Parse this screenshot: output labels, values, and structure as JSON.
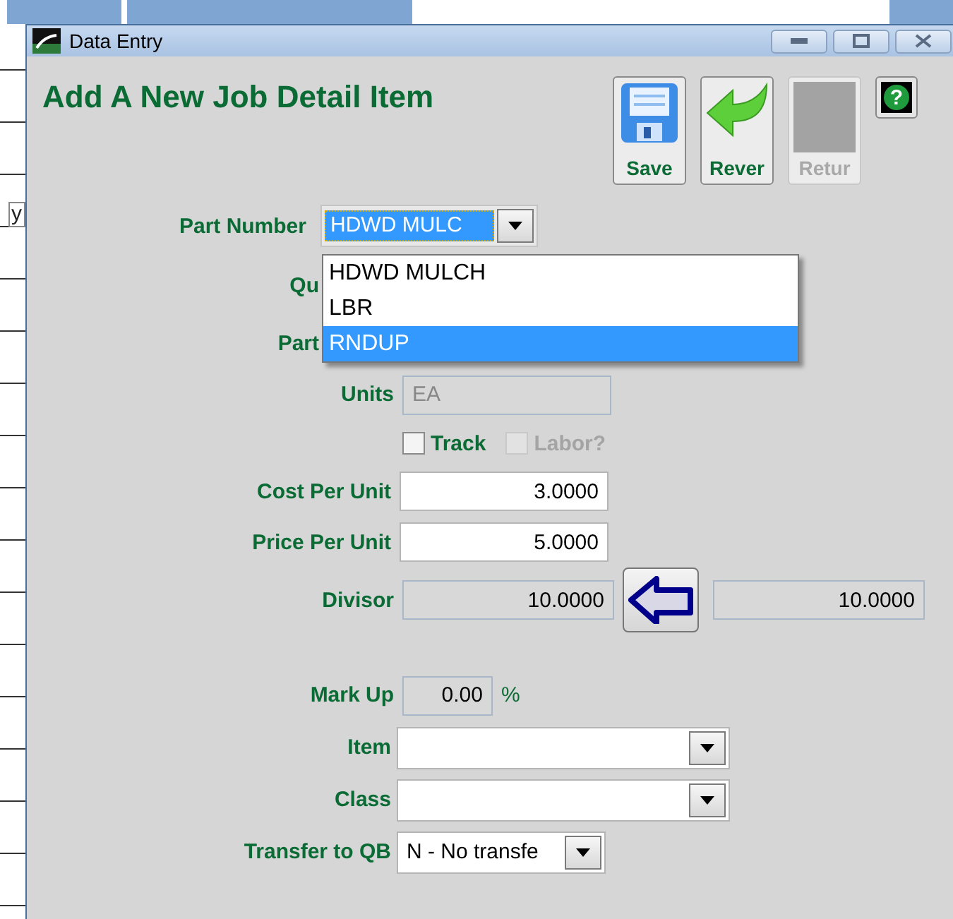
{
  "background": {
    "label": "y"
  },
  "window": {
    "title": "Data Entry"
  },
  "heading": "Add A New Job Detail Item",
  "toolbar": [
    {
      "label": "Save",
      "kind": "save",
      "disabled": false
    },
    {
      "label": "Rever",
      "kind": "revert",
      "disabled": false
    },
    {
      "label": "Retur",
      "kind": "return",
      "disabled": true
    }
  ],
  "help_button": {
    "label": "?"
  },
  "rows": [
    {
      "kind": "combo",
      "label": "Part Number",
      "value": "HDWD MULC",
      "expanded": true,
      "options": [
        {
          "label": "HDWD MULCH",
          "selected": false
        },
        {
          "label": "LBR",
          "selected": false
        },
        {
          "label": "RNDUP",
          "selected": true
        }
      ]
    },
    {
      "kind": "covered",
      "label": "Qu"
    },
    {
      "kind": "covered",
      "label": "Part"
    },
    {
      "kind": "text",
      "label": "Units",
      "value": "EA",
      "disabled": true
    },
    {
      "kind": "checks",
      "items": [
        {
          "label": "Track",
          "checked": false,
          "disabled": false
        },
        {
          "label": "Labor?",
          "checked": false,
          "disabled": true
        }
      ]
    },
    {
      "kind": "number",
      "label": "Cost Per Unit",
      "value": "3.0000",
      "disabled": false
    },
    {
      "kind": "number",
      "label": "Price Per Unit",
      "value": "5.0000",
      "disabled": false
    },
    {
      "kind": "divisor",
      "label": "Divisor",
      "value": "10.0000",
      "result": "10.0000",
      "disabled": true
    },
    {
      "kind": "percent",
      "label": "Mark Up",
      "value": "0.00",
      "suffix": "%",
      "disabled": true
    },
    {
      "kind": "select",
      "label": "Item"
    },
    {
      "kind": "select",
      "label": "Class"
    },
    {
      "kind": "short_select",
      "label": "Transfer to QB",
      "value": "N - No transfe"
    }
  ]
}
